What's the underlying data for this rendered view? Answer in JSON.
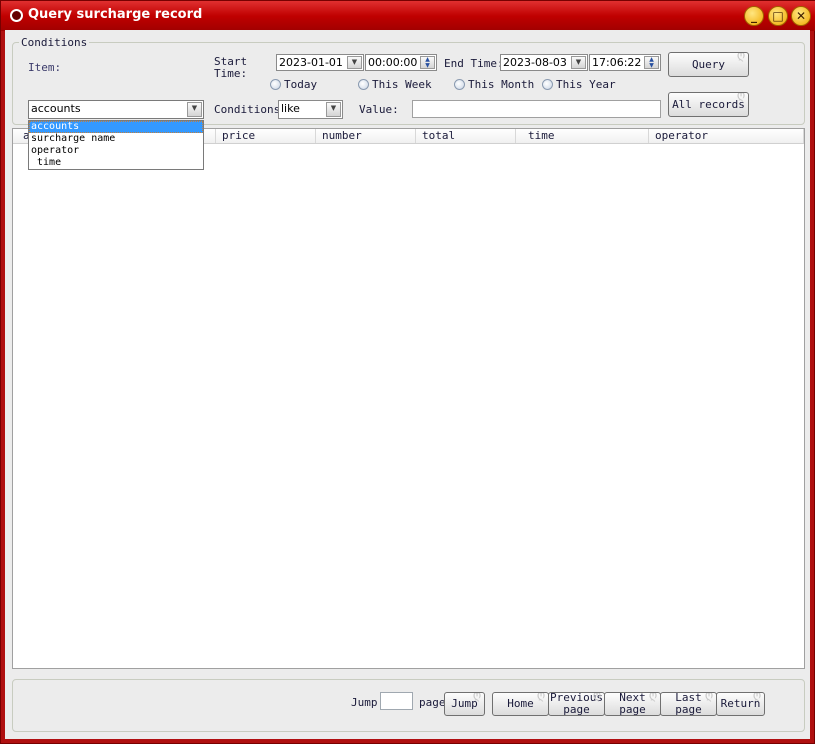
{
  "window": {
    "title": "Query surcharge record",
    "minimize": "_",
    "maximize": "□",
    "close": "✕"
  },
  "conditions": {
    "group_label": "Conditions",
    "item_label": "Item:",
    "item_value": "accounts",
    "item_options": [
      "accounts",
      "surcharge name",
      "operator",
      " time"
    ],
    "start_time_label": "Start Time:",
    "start_date": "2023-01-01",
    "start_time": "00:00:00",
    "end_time_label": "End Time:",
    "end_date": "2023-08-03",
    "end_time": "17:06:22",
    "radios": [
      "Today",
      "This Week",
      "This Month",
      "This Year"
    ],
    "conditions_label": "Conditions:",
    "conditions_value": "like",
    "value_label": "Value:",
    "value": "",
    "query_button": "Query",
    "all_records_button": "All records"
  },
  "table": {
    "columns": [
      "accounts",
      "price",
      "number",
      "total",
      "time",
      "operator"
    ],
    "rows": []
  },
  "pager": {
    "jump_label": "Jump",
    "page_label": "page",
    "page_value": "",
    "jump_button": "Jump",
    "home": "Home",
    "previous": "Previous page",
    "next": "Next page",
    "last": "Last page",
    "return": "Return"
  }
}
